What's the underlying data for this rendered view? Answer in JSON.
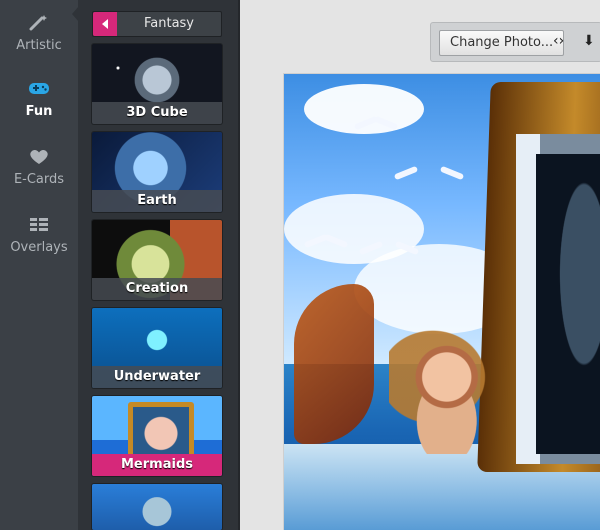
{
  "nav": {
    "items": [
      {
        "key": "artistic",
        "label": "Artistic",
        "icon": "wand-icon"
      },
      {
        "key": "fun",
        "label": "Fun",
        "icon": "gamepad-icon",
        "active": true
      },
      {
        "key": "ecards",
        "label": "E-Cards",
        "icon": "heart-icon"
      },
      {
        "key": "overlays",
        "label": "Overlays",
        "icon": "overlay-grid-icon"
      }
    ]
  },
  "panel": {
    "category_title": "Fantasy",
    "items": [
      {
        "label": "3D Cube"
      },
      {
        "label": "Earth"
      },
      {
        "label": "Creation"
      },
      {
        "label": "Underwater"
      },
      {
        "label": "Mermaids",
        "selected": true
      },
      {
        "label": ""
      }
    ]
  },
  "toolbar": {
    "change_photo_label": "Change Photo...",
    "icons": {
      "compare": "left-right-arrows-icon",
      "download": "download-icon"
    }
  },
  "colors": {
    "accent": "#d6287a",
    "nav_bg": "#3b4046",
    "panel_bg": "#2f3338",
    "workspace_bg": "#e4e4e4"
  }
}
